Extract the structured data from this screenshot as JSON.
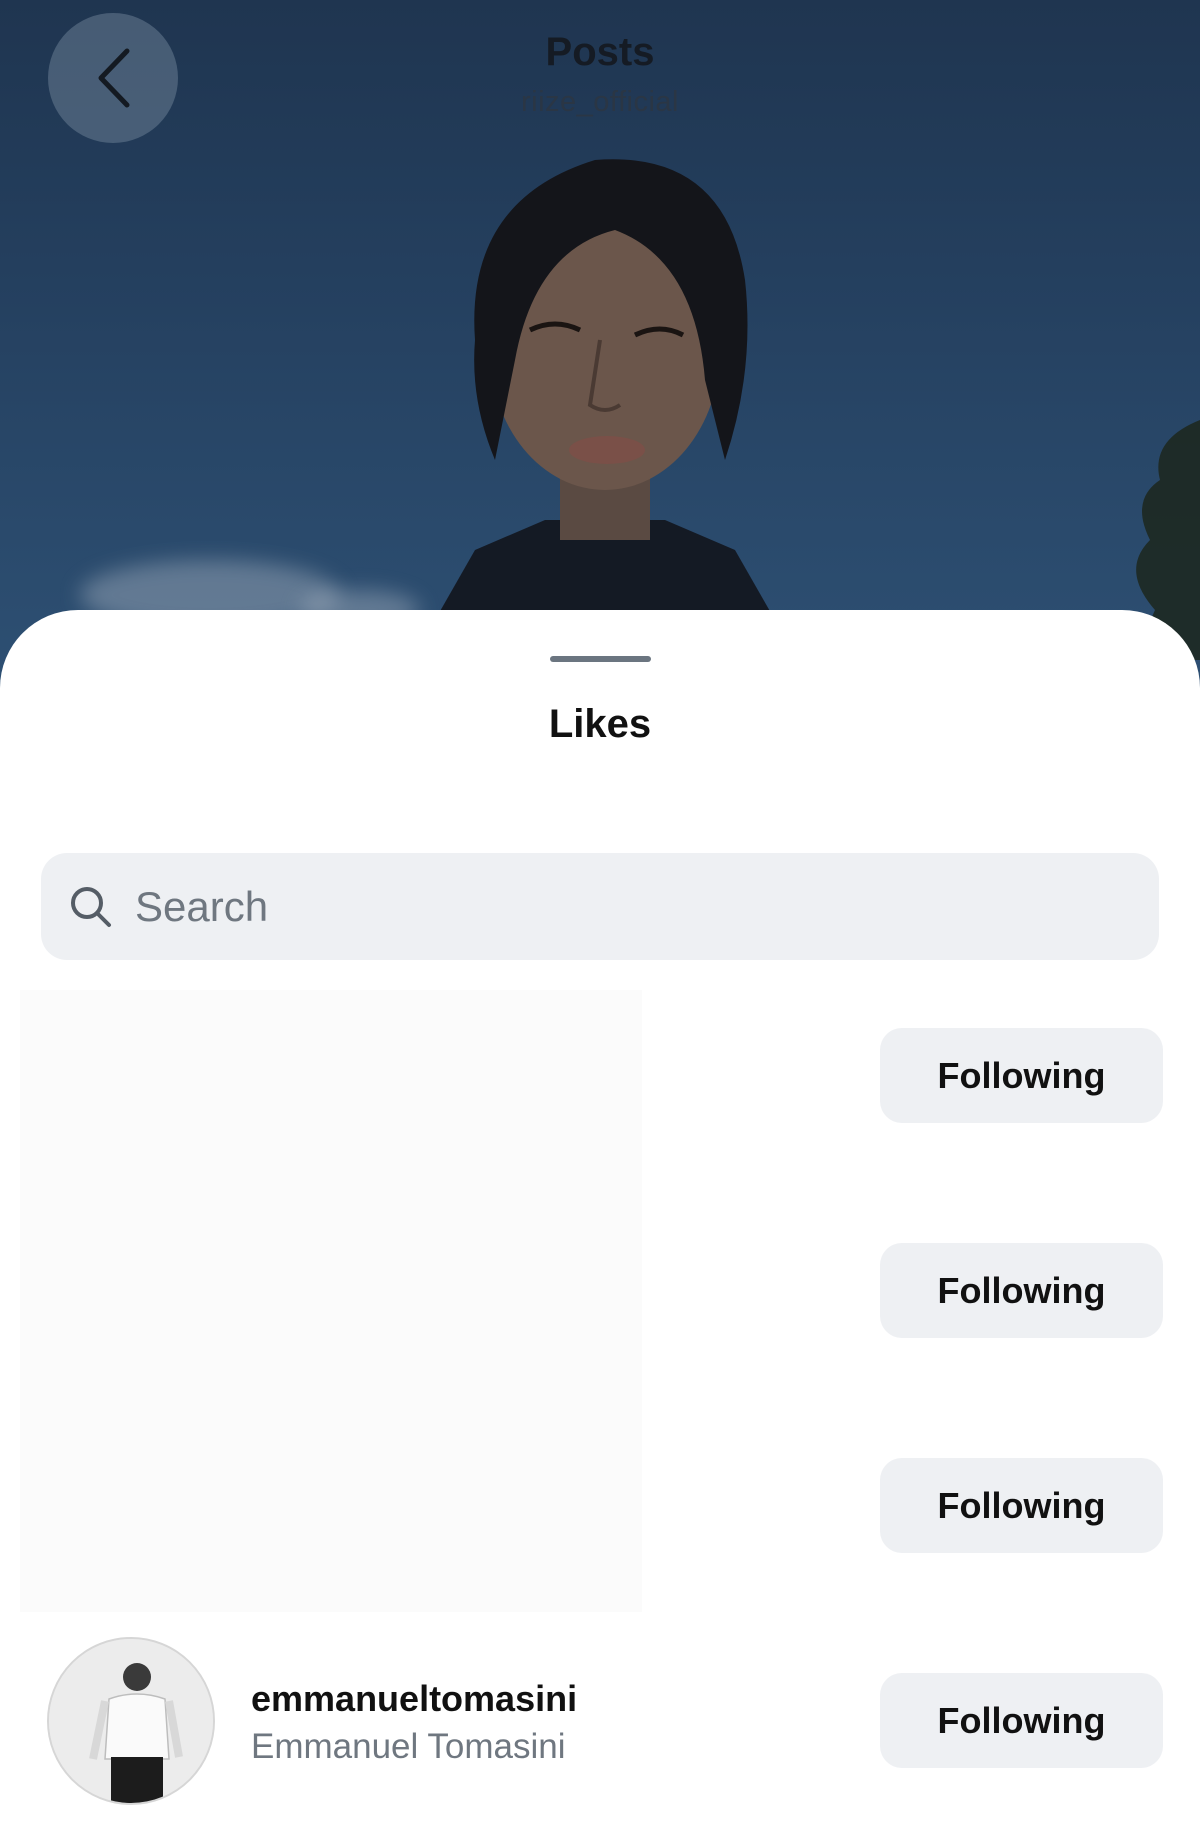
{
  "header": {
    "title": "Posts",
    "subtitle": "riize_official",
    "back_icon": "chevron-left-icon"
  },
  "sheet": {
    "title": "Likes",
    "search": {
      "placeholder": "Search",
      "value": "",
      "icon": "search-icon"
    }
  },
  "likes": [
    {
      "button_label": "Following"
    },
    {
      "button_label": "Following"
    },
    {
      "button_label": "Following"
    },
    {
      "username": "emmanueltomasini",
      "full_name": "Emmanuel Tomasini",
      "button_label": "Following"
    }
  ]
}
